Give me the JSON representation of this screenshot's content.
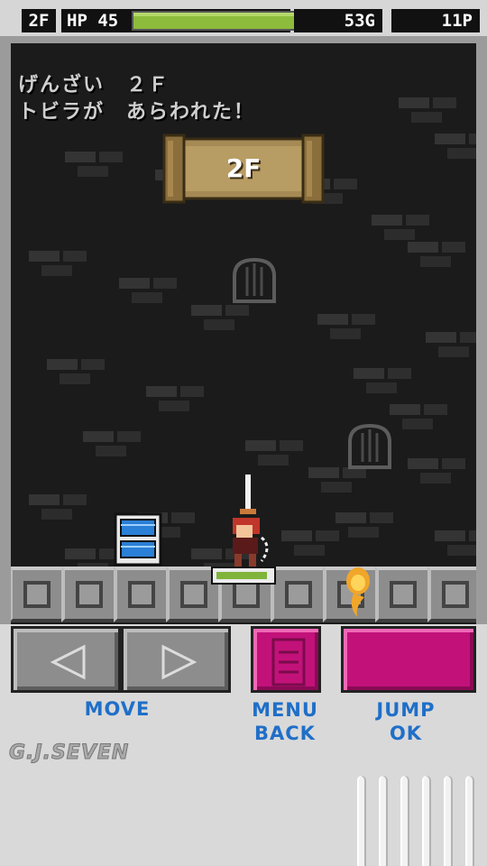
{
  "hud": {
    "floor": "2F",
    "hp_label": "HP 45",
    "hp_fraction": 0.99,
    "gold": "53G",
    "points": "11P"
  },
  "messages": {
    "line1": "げんざい　２Ｆ",
    "line2": "トビラが　あらわれた！"
  },
  "banner": {
    "text": "2F"
  },
  "hero": {
    "hp_fraction": 0.94
  },
  "controls": {
    "move_label": "MOVE",
    "menu_label_1": "MENU",
    "menu_label_2": "BACK",
    "jump_label_1": "JUMP",
    "jump_label_2": "OK"
  },
  "logo": {
    "text": "G.J.SEVEN"
  },
  "colors": {
    "hp_green": "#8dbb3b",
    "accent_magenta": "#c2127a",
    "label_blue": "#1f6fc8"
  },
  "icons": {
    "left": "arrow-left-icon",
    "right": "arrow-right-icon",
    "menu": "menu-lines-icon"
  }
}
